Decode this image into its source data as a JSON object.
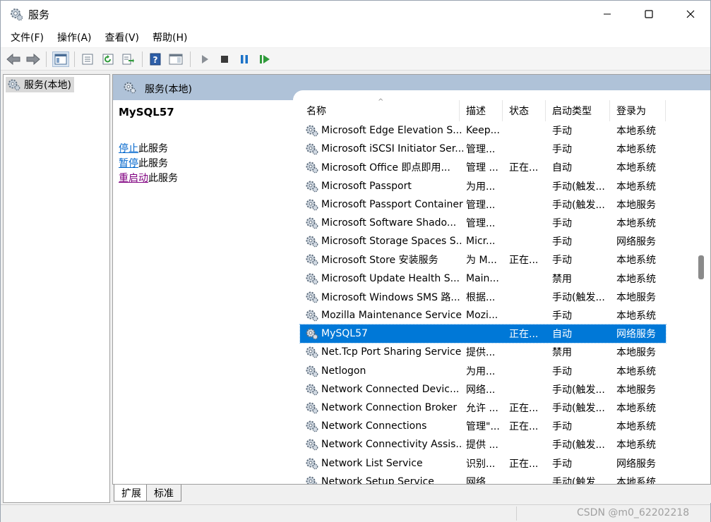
{
  "window": {
    "title": "服务"
  },
  "menu": [
    "文件(F)",
    "操作(A)",
    "查看(V)",
    "帮助(H)"
  ],
  "toolbar": {
    "buttons": [
      "back-icon",
      "forward-icon",
      "show-hide-console-tree-icon",
      "properties-icon",
      "refresh-icon",
      "export-list-icon",
      "help-icon",
      "show-hide-action-pane-icon",
      "start-service-icon",
      "stop-service-icon",
      "pause-service-icon",
      "restart-service-icon"
    ]
  },
  "tree": {
    "root_label": "服务(本地)"
  },
  "pane": {
    "header": "服务(本地)",
    "selected_service": "MySQL57",
    "actions": [
      {
        "link": "停止",
        "rest": "此服务"
      },
      {
        "link": "暂停",
        "rest": "此服务"
      },
      {
        "link": "重启动",
        "rest": "此服务"
      }
    ]
  },
  "list": {
    "columns": [
      "名称",
      "描述",
      "状态",
      "启动类型",
      "登录为"
    ],
    "rows": [
      {
        "name": "Microsoft Edge Elevation S...",
        "desc": "Keep...",
        "status": "",
        "start": "手动",
        "logon": "本地系统"
      },
      {
        "name": "Microsoft iSCSI Initiator Ser...",
        "desc": "管理...",
        "status": "",
        "start": "手动",
        "logon": "本地系统"
      },
      {
        "name": "Microsoft Office 即点即用...",
        "desc": "管理 ...",
        "status": "正在...",
        "start": "自动",
        "logon": "本地系统"
      },
      {
        "name": "Microsoft Passport",
        "desc": "为用...",
        "status": "",
        "start": "手动(触发...",
        "logon": "本地系统"
      },
      {
        "name": "Microsoft Passport Container",
        "desc": "管理...",
        "status": "",
        "start": "手动(触发...",
        "logon": "本地服务"
      },
      {
        "name": "Microsoft Software Shado...",
        "desc": "管理...",
        "status": "",
        "start": "手动",
        "logon": "本地系统"
      },
      {
        "name": "Microsoft Storage Spaces S...",
        "desc": "Micr...",
        "status": "",
        "start": "手动",
        "logon": "网络服务"
      },
      {
        "name": "Microsoft Store 安装服务",
        "desc": "为 M...",
        "status": "正在...",
        "start": "手动",
        "logon": "本地系统"
      },
      {
        "name": "Microsoft Update Health S...",
        "desc": "Main...",
        "status": "",
        "start": "禁用",
        "logon": "本地系统"
      },
      {
        "name": "Microsoft Windows SMS 路...",
        "desc": "根据...",
        "status": "",
        "start": "手动(触发...",
        "logon": "本地服务"
      },
      {
        "name": "Mozilla Maintenance Service",
        "desc": "Mozi...",
        "status": "",
        "start": "手动",
        "logon": "本地系统"
      },
      {
        "name": "MySQL57",
        "desc": "",
        "status": "正在...",
        "start": "自动",
        "logon": "网络服务",
        "selected": true
      },
      {
        "name": "Net.Tcp Port Sharing Service",
        "desc": "提供...",
        "status": "",
        "start": "禁用",
        "logon": "本地服务"
      },
      {
        "name": "Netlogon",
        "desc": "为用...",
        "status": "",
        "start": "手动",
        "logon": "本地系统"
      },
      {
        "name": "Network Connected Devic...",
        "desc": "网络...",
        "status": "",
        "start": "手动(触发...",
        "logon": "本地服务"
      },
      {
        "name": "Network Connection Broker",
        "desc": "允许 ...",
        "status": "正在...",
        "start": "手动(触发...",
        "logon": "本地系统"
      },
      {
        "name": "Network Connections",
        "desc": "管理\"...",
        "status": "正在...",
        "start": "手动",
        "logon": "本地系统"
      },
      {
        "name": "Network Connectivity Assis...",
        "desc": "提供 ...",
        "status": "",
        "start": "手动(触发...",
        "logon": "本地系统"
      },
      {
        "name": "Network List Service",
        "desc": "识别...",
        "status": "正在...",
        "start": "手动",
        "logon": "网络服务"
      },
      {
        "name": "Network Setup Service",
        "desc": "网络...",
        "status": "",
        "start": "手动(触发...",
        "logon": "本地系统"
      }
    ]
  },
  "tabs": [
    "扩展",
    "标准"
  ],
  "statusbar": {
    "watermark": "CSDN @m0_62202218"
  },
  "colors": {
    "selection": "#0078d7",
    "pane_header": "#afc2d8",
    "link": "#0066cc",
    "visited_link": "#800080"
  }
}
